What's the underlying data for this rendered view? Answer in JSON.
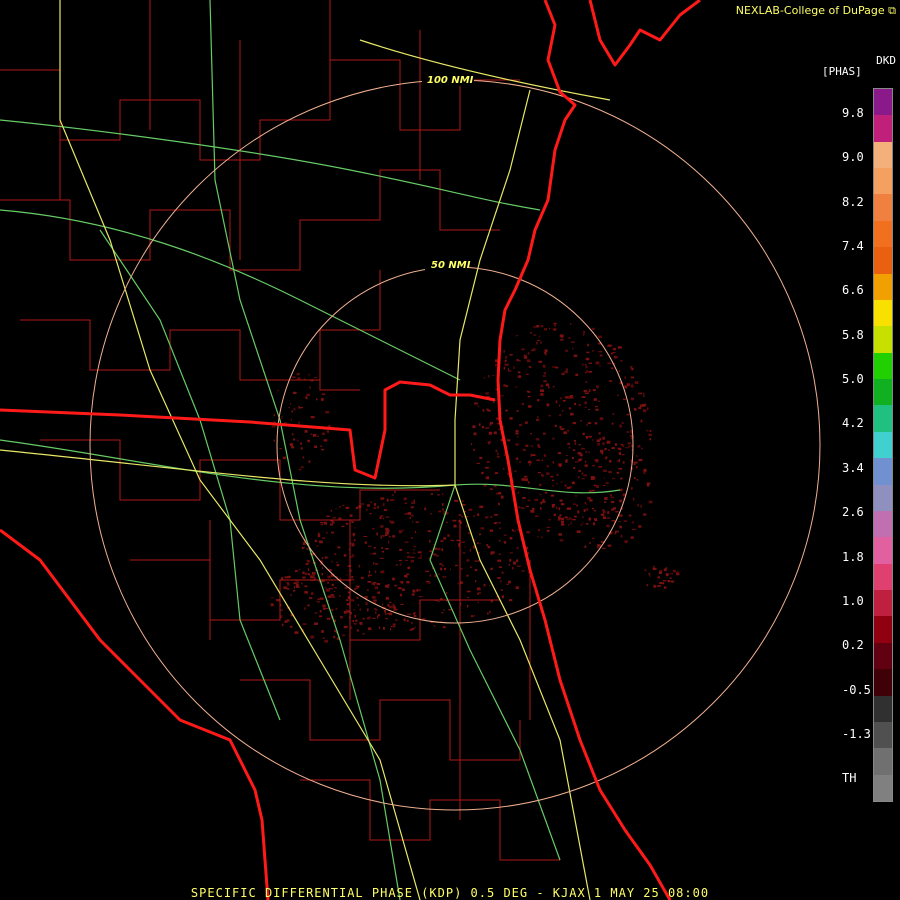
{
  "credit": "NEXLAB-College of DuPage",
  "credit_icon": "external-link-icon",
  "legend": {
    "title_line1": "DKD",
    "title_line2": "[PHAS]",
    "ticks": [
      "9.8",
      "9.0",
      "8.2",
      "7.4",
      "6.6",
      "5.8",
      "5.0",
      "4.2",
      "3.4",
      "2.6",
      "1.8",
      "1.0",
      "0.2",
      "-0.5",
      "-1.3",
      "TH"
    ],
    "colors": [
      "#8a1a8a",
      "#c0207a",
      "#f4b07a",
      "#f4a060",
      "#f08040",
      "#f07020",
      "#e86010",
      "#f0a000",
      "#f8e000",
      "#c8e000",
      "#20d000",
      "#10b020",
      "#20c080",
      "#40d0d0",
      "#7090d0",
      "#9090c0",
      "#c070b0",
      "#e060a0",
      "#e04070",
      "#c02040",
      "#900010",
      "#600010",
      "#400008",
      "#303030",
      "#505050",
      "#707070",
      "#808080"
    ],
    "accent_border": "#888888"
  },
  "rings": [
    {
      "label": "50 NMI"
    },
    {
      "label": "100 NMI"
    }
  ],
  "colors": {
    "coast_state": "#ff1a1a",
    "county": "#b01818",
    "highway_green": "#66cc66",
    "highway_yellow": "#e8e866",
    "range_ring": "#f0b090",
    "echo": "#7a1010"
  },
  "footer": "SPECIFIC DIFFERENTIAL PHASE (KDP) 0.5 DEG - KJAX 1 MAY 25 08:00"
}
